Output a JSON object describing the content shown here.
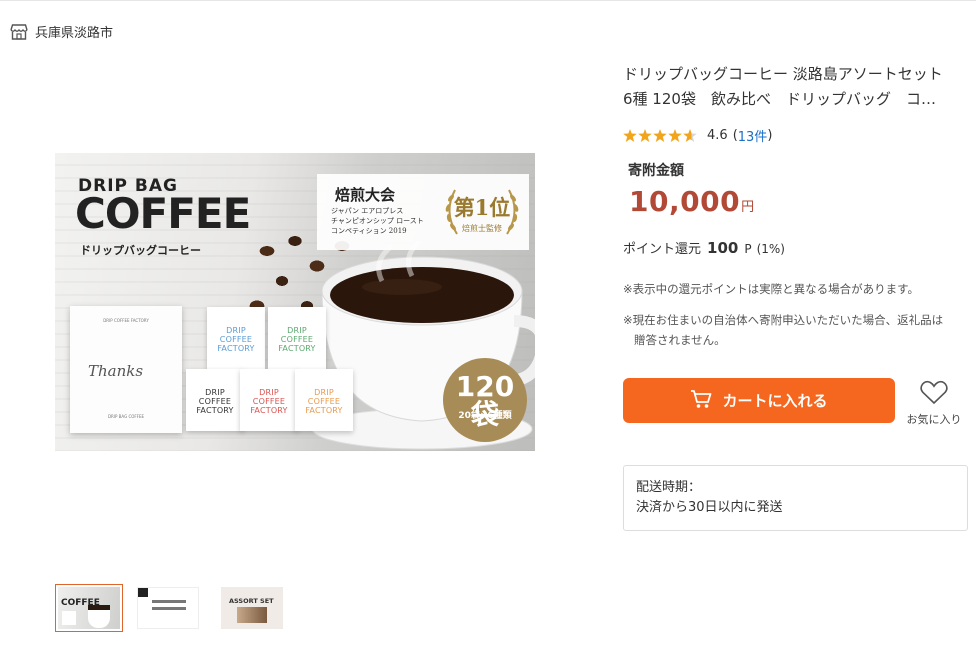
{
  "header": {
    "location": "兵庫県淡路市",
    "location_icon": "store-icon"
  },
  "product_image": {
    "drip_bag": "DRIP BAG",
    "coffee": "COFFEE",
    "coffee_sub": "ドリップバッグコーヒー",
    "award_title": "焙煎大会",
    "award_line1": "ジャパン エアロプレス",
    "award_line2": "チャンピオンシップ ロースト",
    "award_line3": "コンペティション 2019",
    "medal_rank": "第1位",
    "medal_sub": "焙煎士監修",
    "big_bag_top": "DRIP COFFEE FACTORY",
    "big_bag_script": "Thanks",
    "big_bag_bottom": "DRIP BAG COFFEE",
    "small_bags": [
      {
        "l1": "DRIP",
        "l2": "COFFEE",
        "l3": "FACTORY",
        "color": "#5a9bd6"
      },
      {
        "l1": "DRIP",
        "l2": "COFFEE",
        "l3": "FACTORY",
        "color": "#5aa86e"
      },
      {
        "l1": "DRIP",
        "l2": "COFFEE",
        "l3": "FACTORY",
        "color": "#333333"
      },
      {
        "l1": "DRIP",
        "l2": "COFFEE",
        "l3": "FACTORY",
        "color": "#d9534f"
      },
      {
        "l1": "DRIP",
        "l2": "COFFEE",
        "l3": "FACTORY",
        "color": "#e89a4a"
      }
    ],
    "badge_number": "120袋",
    "badge_detail": "20袋×6種類"
  },
  "thumbnails": [
    {
      "title": "COFFEE",
      "selected": true
    },
    {
      "title": "",
      "selected": false
    },
    {
      "title": "ASSORT SET",
      "selected": false
    }
  ],
  "product": {
    "title_line1": "ドリップバッグコーヒー 淡路島アソートセット",
    "title_line2": "6種 120袋　飲み比べ　ドリップバッグ　コ…",
    "rating_value": "4.6",
    "rating_count_open": "(",
    "rating_count_link": "13件",
    "rating_count_close": ")",
    "stars": 4.6,
    "amount_label": "寄附金額",
    "price": "10,000",
    "price_unit": "円",
    "points_label": "ポイント還元",
    "points_value": "100",
    "points_unit": "P",
    "points_pct": "(1%)",
    "note1": "※表示中の還元ポイントは実際と異なる場合があります。",
    "note2_line1": "※現在お住まいの自治体へ寄附申込いただいた場合、返礼品は",
    "note2_line2": "贈答されません。",
    "cart_button": "カートに入れる",
    "favorite_label": "お気に入り",
    "shipping_label": "配送時期：",
    "shipping_value": "決済から30日以内に発送"
  },
  "colors": {
    "accent": "#f5661f",
    "price": "#b24936",
    "star": "#f2a51a",
    "link": "#1a6fc9"
  }
}
